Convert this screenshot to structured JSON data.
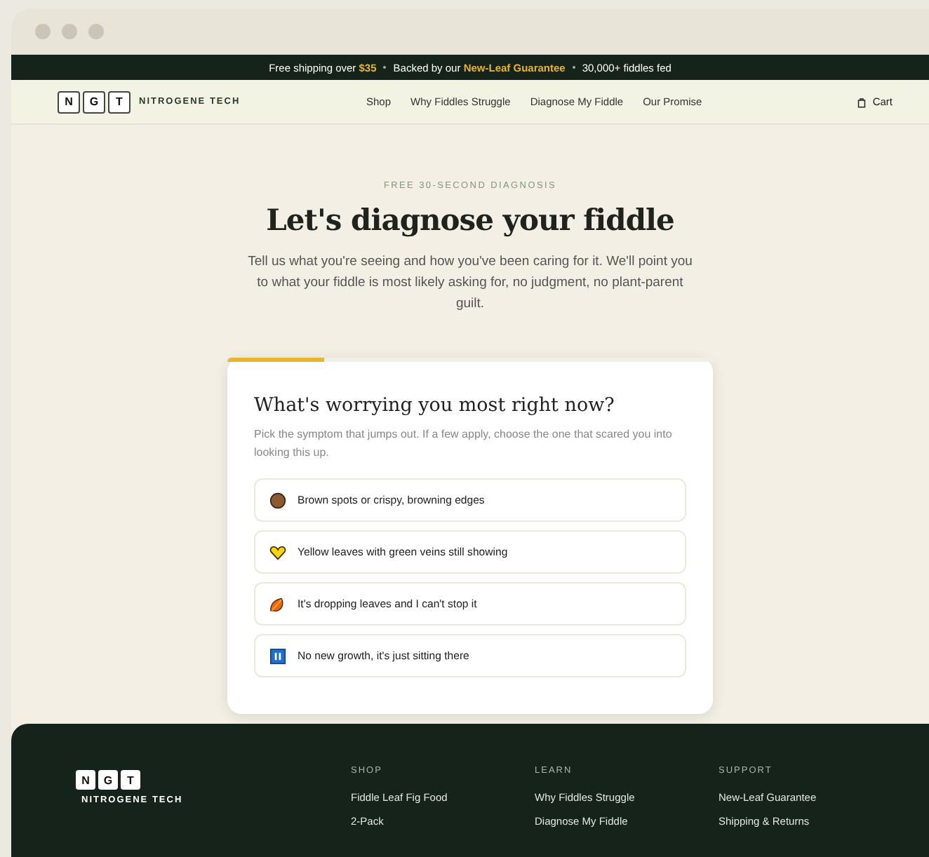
{
  "announcement": {
    "parts": [
      "Free shipping over **$35**",
      "Backed by our **New-Leaf Guarantee**",
      "30,000+ fiddles fed"
    ]
  },
  "nav": {
    "logo_letters": [
      "N",
      "G",
      "T"
    ],
    "brand": "NITROGENE TECH",
    "links": [
      "Shop",
      "Why Fiddles Struggle",
      "Diagnose My Fiddle",
      "Our Promise"
    ],
    "cart": "Cart"
  },
  "hero": {
    "eyebrow": "FREE 30-SECOND DIAGNOSIS",
    "title": "Let's diagnose your fiddle",
    "intro": "Tell us what you're seeing and how you've been caring for it. We'll point you to what your fiddle is most likely asking for, no judgment, no plant-parent guilt."
  },
  "quiz": {
    "progress": {
      "level": 0.2
    },
    "question": "What's worrying you most right now?",
    "hint": "Pick the symptom that jumps out. If a few apply, choose the one that scared you into looking this up.",
    "options": [
      {
        "label": "Brown spots or crispy, browning edges"
      },
      {
        "label": "Yellow leaves with green veins still showing"
      },
      {
        "label": "It's dropping leaves and I can't stop it"
      },
      {
        "label": "No new growth, it's just sitting there"
      }
    ]
  },
  "footer": {
    "logo_letters": [
      "N",
      "G",
      "T"
    ],
    "brand": "NITROGENE TECH",
    "columns": [
      {
        "heading": "SHOP",
        "links": [
          "Fiddle Leaf Fig Food",
          "2-Pack"
        ]
      },
      {
        "heading": "LEARN",
        "links": [
          "Why Fiddles Struggle",
          "Diagnose My Fiddle"
        ]
      },
      {
        "heading": "SUPPORT",
        "links": [
          "New-Leaf Guarantee",
          "Shipping & Returns"
        ]
      }
    ]
  }
}
